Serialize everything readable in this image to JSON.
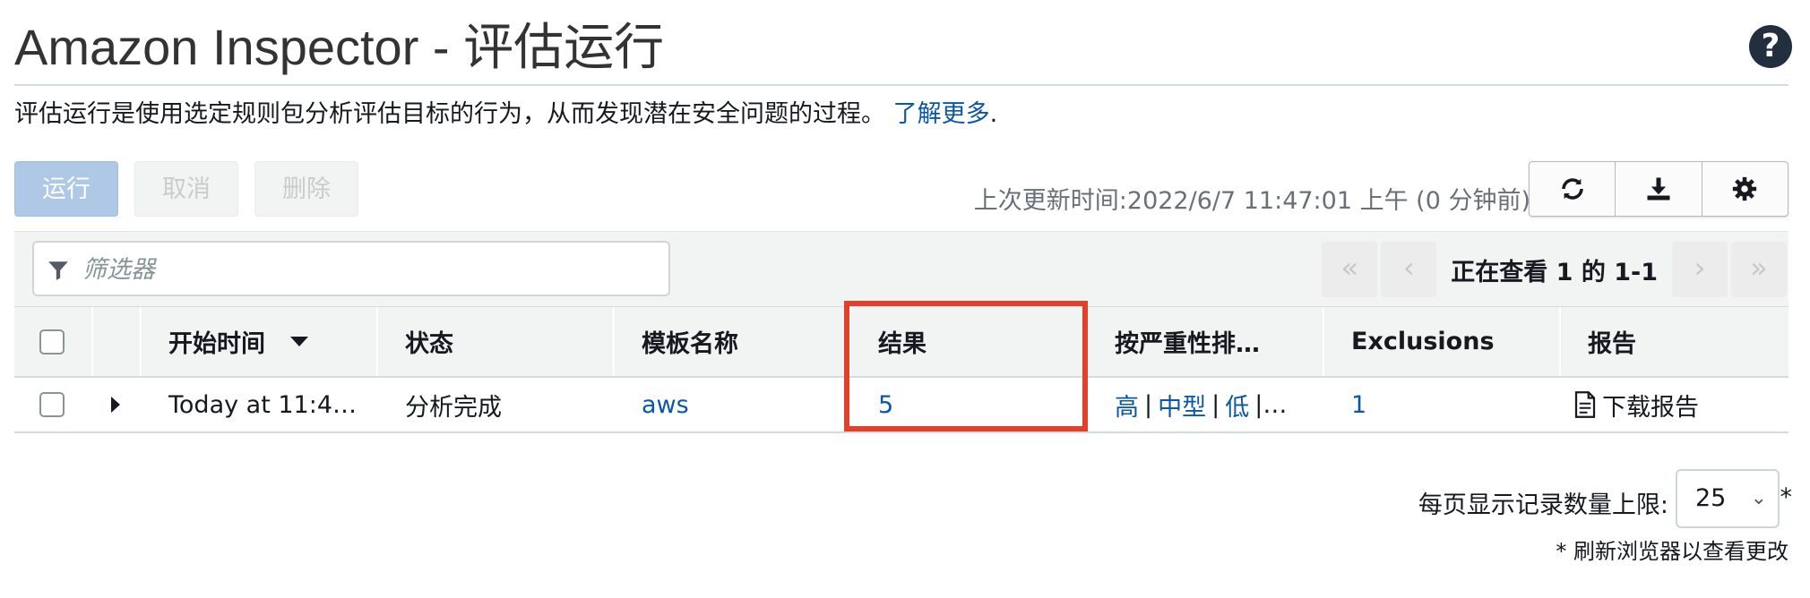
{
  "header": {
    "title": "Amazon Inspector - 评估运行",
    "help_icon": "question-circle-icon"
  },
  "description": {
    "text": "评估运行是使用选定规则包分析评估目标的行为，从而发现潜在安全问题的过程。",
    "learn_more": "了解更多",
    "period": "."
  },
  "actions": {
    "run": "运行",
    "cancel": "取消",
    "delete": "删除"
  },
  "last_updated": "上次更新时间:2022/6/7 11:47:01 上午 (0 分钟前)",
  "toolbar_icons": [
    "refresh-icon",
    "download-icon",
    "settings-gear-icon"
  ],
  "filter": {
    "placeholder": "筛选器",
    "icon": "funnel-icon"
  },
  "pagination": {
    "label": "正在查看 1 的 1-1",
    "first": "«",
    "prev": "‹",
    "next": "›",
    "last": "»"
  },
  "table": {
    "columns": {
      "start_time": "开始时间",
      "status": "状态",
      "template": "模板名称",
      "findings": "结果",
      "by_severity": "按严重性排…",
      "exclusions": "Exclusions",
      "report": "报告"
    },
    "rows": [
      {
        "start_time": "Today at 11:4…",
        "status": "分析完成",
        "template": "aws",
        "findings": "5",
        "severity": {
          "high": "高",
          "sep1": "|",
          "medium": "中型",
          "sep2": "|",
          "low": "低",
          "rest": "|…"
        },
        "exclusions": "1",
        "report": "下载报告"
      }
    ]
  },
  "footer": {
    "per_page_label": "每页显示记录数量上限:",
    "per_page_value": "25",
    "asterisk": "*",
    "refresh_note": "* 刷新浏览器以查看更改"
  },
  "colors": {
    "highlight": "#e0412c",
    "link": "#0b57a7"
  }
}
